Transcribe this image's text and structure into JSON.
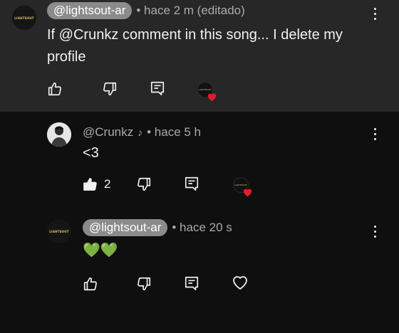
{
  "comments": [
    {
      "avatar_text": "LIGHTSOUT",
      "handle": "@lightsout-ar",
      "meta": "• hace 2 m (editado)",
      "text_line1": "If @Crunkz comment in this song... I delete my",
      "text_line2": "profile",
      "like_count": "",
      "creator_heart": true,
      "creator_avatar_text": "LIGHTSOUT"
    },
    {
      "handle": "@Crunkz",
      "artist_note": "♪",
      "meta": "• hace 5 h",
      "text": "<3",
      "like_count": "2",
      "liked": true,
      "creator_heart": true,
      "creator_avatar_text": "LIGHTSOUT"
    },
    {
      "avatar_text": "LIGHTSOUT",
      "handle": "@lightsout-ar",
      "meta": "• hace 20 s",
      "text": "💚💚",
      "creator_heart": false
    }
  ],
  "colors": {
    "background": "#0f0f0f",
    "highlight_background": "#272727",
    "pill": "#8b8b8b",
    "muted_text": "#aaaaaa",
    "heart_red": "#e11d2a",
    "green_heart": "#7ed321"
  }
}
